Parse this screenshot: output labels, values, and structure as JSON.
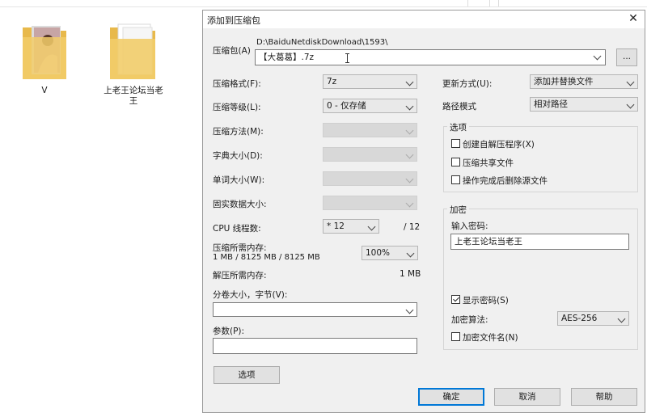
{
  "desktop": {
    "folders": [
      {
        "name": "V"
      },
      {
        "name": "上老王论坛当老王"
      }
    ]
  },
  "dialog": {
    "title": "添加到压缩包",
    "archive": {
      "label": "压缩包(A)",
      "path": "D:\\BaiduNetdiskDownload\\1593\\",
      "value": "【大葛葛】.7z",
      "browse_label": "..."
    },
    "left": {
      "format": {
        "label": "压缩格式(F):",
        "value": "7z"
      },
      "level": {
        "label": "压缩等级(L):",
        "value": "0 - 仅存储"
      },
      "method": {
        "label": "压缩方法(M):",
        "value": ""
      },
      "dict": {
        "label": "字典大小(D):",
        "value": ""
      },
      "word": {
        "label": "单词大小(W):",
        "value": ""
      },
      "solid": {
        "label": "固实数据大小:",
        "value": ""
      },
      "threads": {
        "label": "CPU 线程数:",
        "value": "* 12",
        "max": "/ 12"
      },
      "mem_compress": {
        "label": "压缩所需内存:",
        "detail": "1 MB / 8125 MB / 8125 MB",
        "value": "100%"
      },
      "mem_decompress": {
        "label": "解压所需内存:",
        "value": "1 MB"
      },
      "volume": {
        "label": "分卷大小，字节(V):",
        "value": ""
      },
      "params": {
        "label": "参数(P):",
        "value": ""
      },
      "options_button": "选项"
    },
    "right": {
      "update": {
        "label": "更新方式(U):",
        "value": "添加并替换文件"
      },
      "pathmode": {
        "label": "路径模式",
        "value": "相对路径"
      },
      "options_group": {
        "title": "选项",
        "sfx": {
          "label": "创建自解压程序(X)",
          "checked": false
        },
        "shared": {
          "label": "压缩共享文件",
          "checked": false
        },
        "delete": {
          "label": "操作完成后删除源文件",
          "checked": false
        }
      },
      "encrypt_group": {
        "title": "加密",
        "pwd_label": "输入密码:",
        "pwd_value": "上老王论坛当老王",
        "show_pwd": {
          "label": "显示密码(S)",
          "checked": true
        },
        "algo_label": "加密算法:",
        "algo_value": "AES-256",
        "encrypt_names": {
          "label": "加密文件名(N)",
          "checked": false
        }
      }
    },
    "buttons": {
      "ok": "确定",
      "cancel": "取消",
      "help": "帮助"
    }
  }
}
